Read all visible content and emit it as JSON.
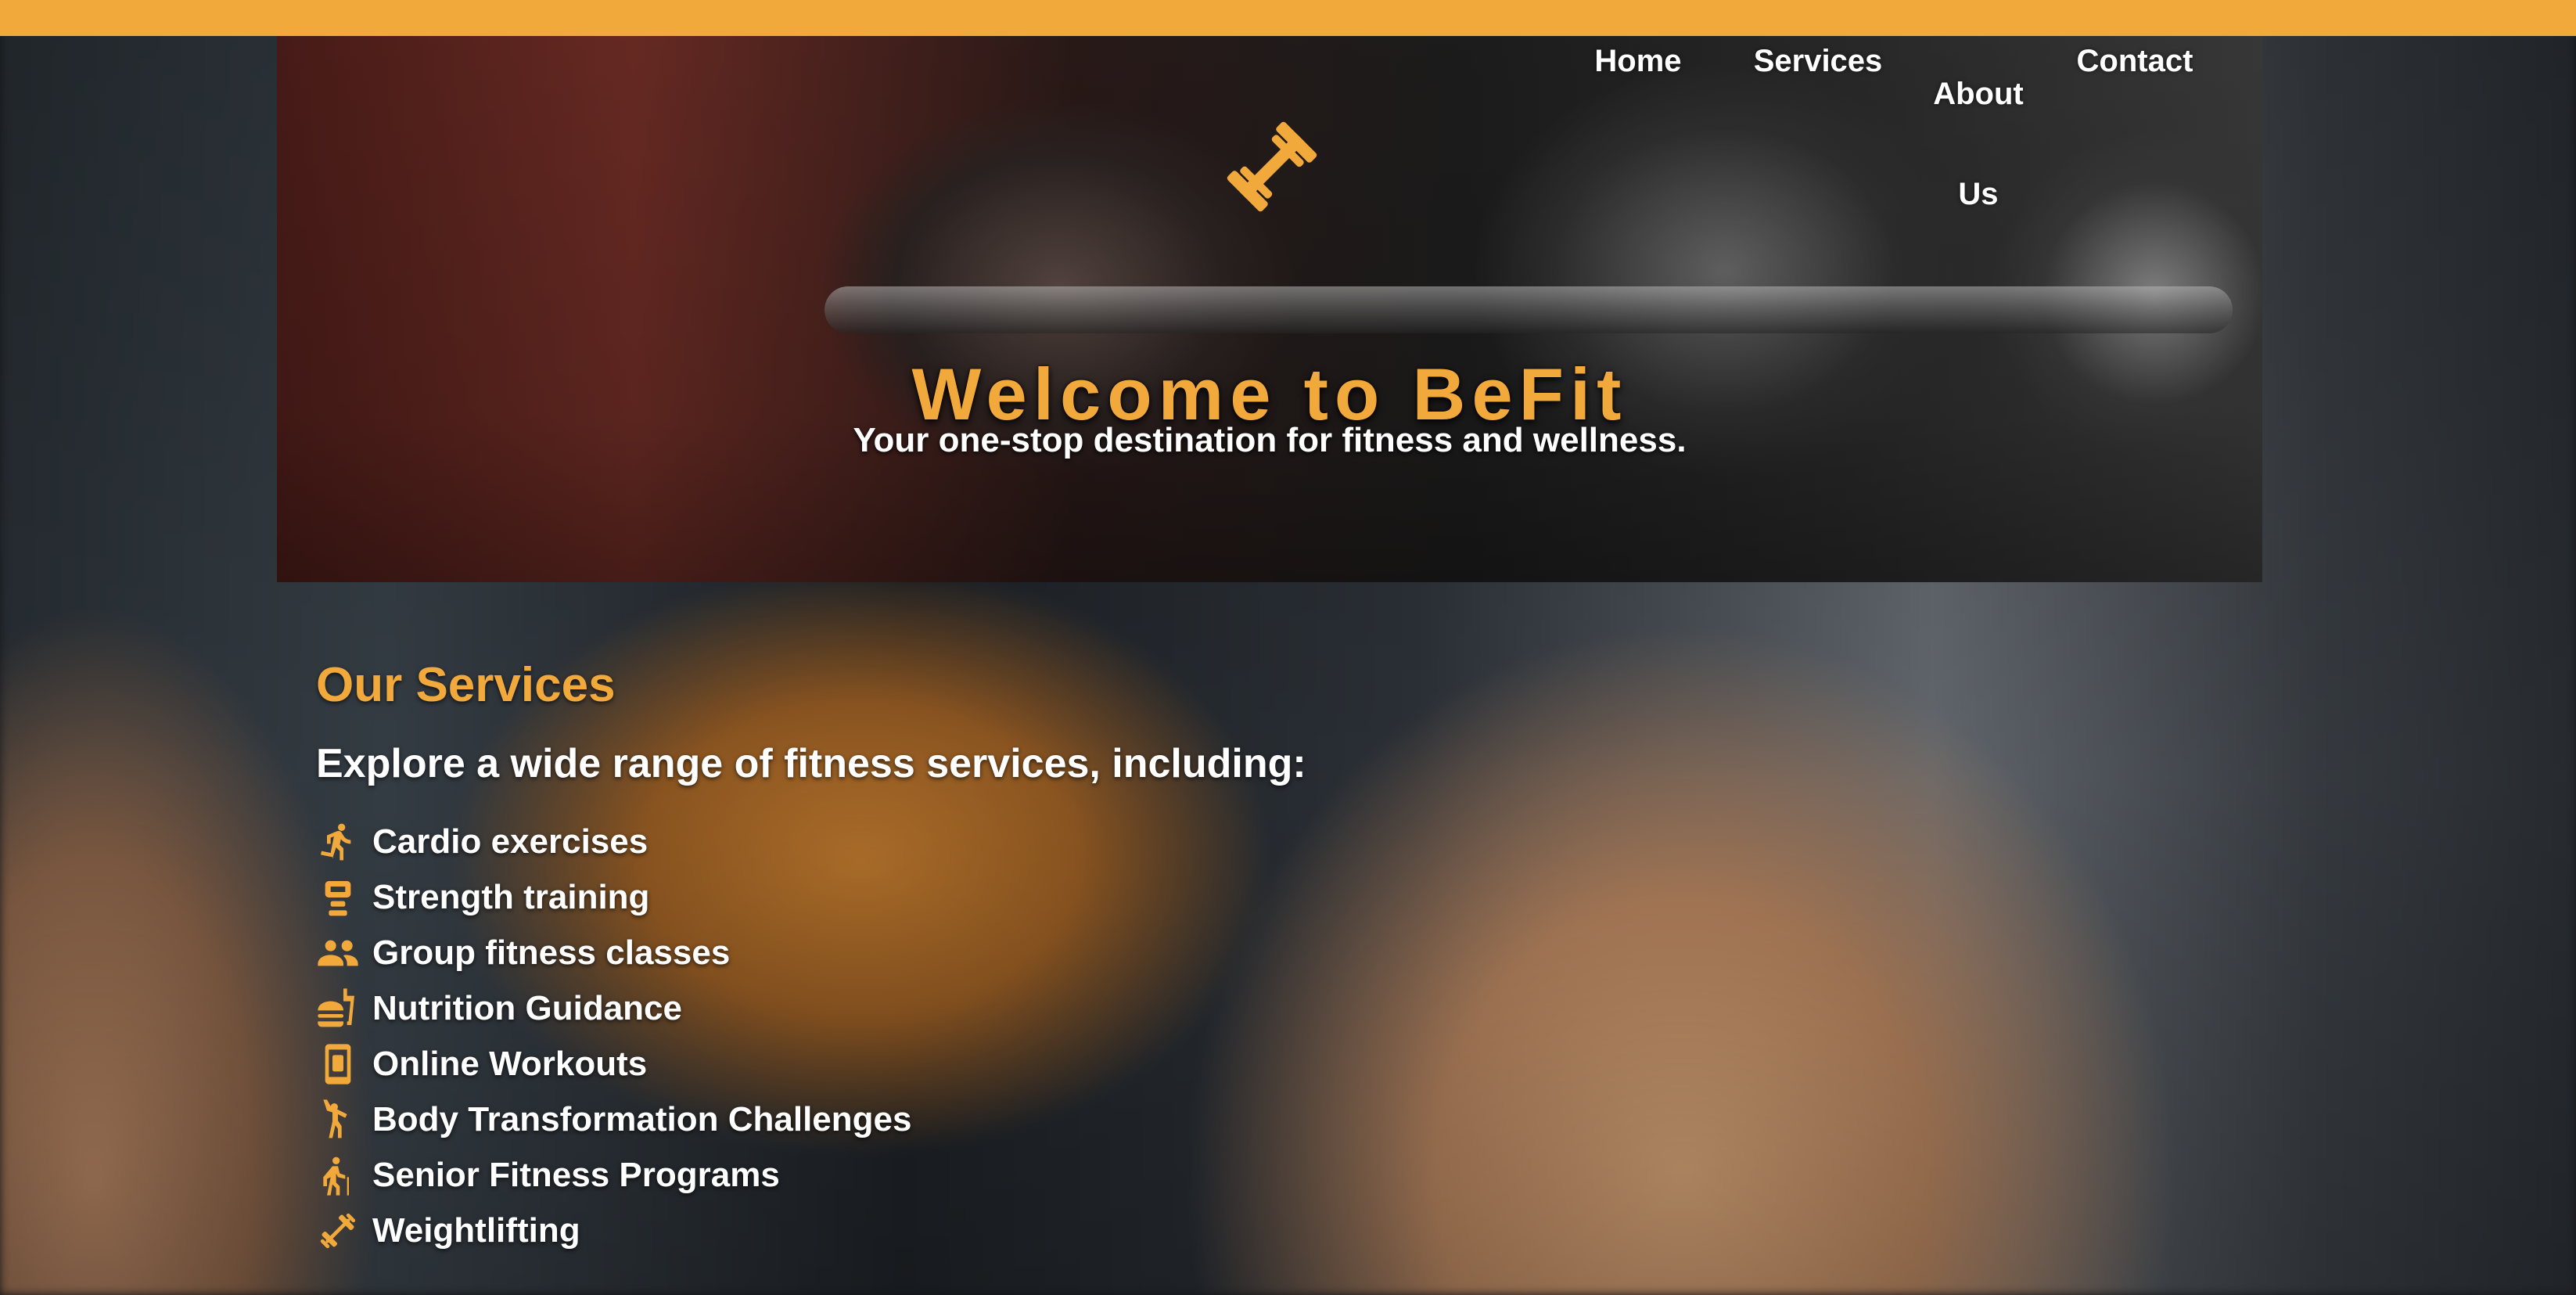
{
  "header": {
    "nav": [
      {
        "label": "Home"
      },
      {
        "label": "Services"
      },
      {
        "label": "About Us"
      },
      {
        "label": "Contact"
      }
    ],
    "logo_icon": "dumbbell-icon"
  },
  "hero": {
    "title": "Welcome to BeFit",
    "subtitle": "Your one-stop destination for fitness and wellness."
  },
  "services": {
    "title": "Our Services",
    "intro": "Explore a wide range of fitness services, including:",
    "items": [
      {
        "label": "Cardio exercises",
        "icon": "running-icon"
      },
      {
        "label": "Strength training",
        "icon": "kettlebell-icon"
      },
      {
        "label": "Group fitness classes",
        "icon": "group-icon"
      },
      {
        "label": "Nutrition Guidance",
        "icon": "burger-drink-icon"
      },
      {
        "label": "Online Workouts",
        "icon": "mobile-device-icon"
      },
      {
        "label": "Body Transformation Challenges",
        "icon": "person-raising-arm-icon"
      },
      {
        "label": "Senior Fitness Programs",
        "icon": "person-with-cane-icon"
      },
      {
        "label": "Weightlifting",
        "icon": "dumbbell-icon"
      }
    ]
  },
  "colors": {
    "accent": "#f2a93b",
    "text": "#ffffff"
  }
}
